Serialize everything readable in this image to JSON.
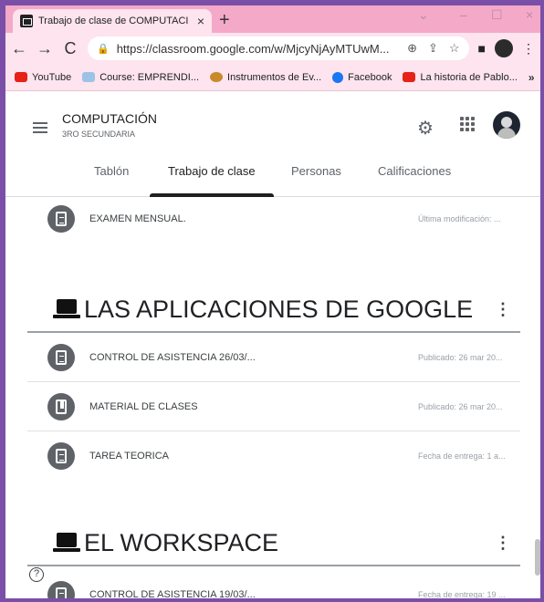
{
  "browser": {
    "tab_title": "Trabajo de clase de COMPUTACI",
    "tab_close": "×",
    "new_tab": "+",
    "window_controls": [
      "⌄",
      "–",
      "☐",
      "×"
    ],
    "back": "←",
    "forward": "→",
    "reload": "C",
    "url": "https://classroom.google.com/w/MjcyNjAyMTUwM...",
    "bookmarks": [
      {
        "label": "YouTube",
        "color": "#e62117"
      },
      {
        "label": "Course: EMPRENDI...",
        "color": "#9cc3e6"
      },
      {
        "label": "Instrumentos de Ev...",
        "color": "#c98a2c"
      },
      {
        "label": "Facebook",
        "color": "#1877f2"
      },
      {
        "label": "La historia de Pablo...",
        "color": "#e62117"
      }
    ],
    "bookmarks_more": "»"
  },
  "classroom": {
    "class_name": "COMPUTACIÓN",
    "class_section": "3RO SECUNDARIA",
    "tabs": [
      "Tablón",
      "Trabajo de clase",
      "Personas",
      "Calificaciones"
    ],
    "active_tab": "Trabajo de clase"
  },
  "items_top": [
    {
      "title": "EXAMEN MENSUAL.",
      "meta": "Última modificación: ..."
    }
  ],
  "topic1": {
    "title": "LAS APLICACIONES DE GOOGLE",
    "menu": "⋮",
    "items": [
      {
        "title": "CONTROL DE ASISTENCIA 26/03/...",
        "meta": "Publicado: 26 mar 20..."
      },
      {
        "title": "MATERIAL DE CLASES",
        "meta": "Publicado: 26 mar 20..."
      },
      {
        "title": "TAREA TEORICA",
        "meta": "Fecha de entrega: 1 a..."
      }
    ]
  },
  "topic2": {
    "title": "EL WORKSPACE",
    "menu": "⋮",
    "items": [
      {
        "title": "CONTROL DE ASISTENCIA 19/03/...",
        "meta": "Fecha de entrega: 19 ..."
      }
    ]
  },
  "help": "?"
}
